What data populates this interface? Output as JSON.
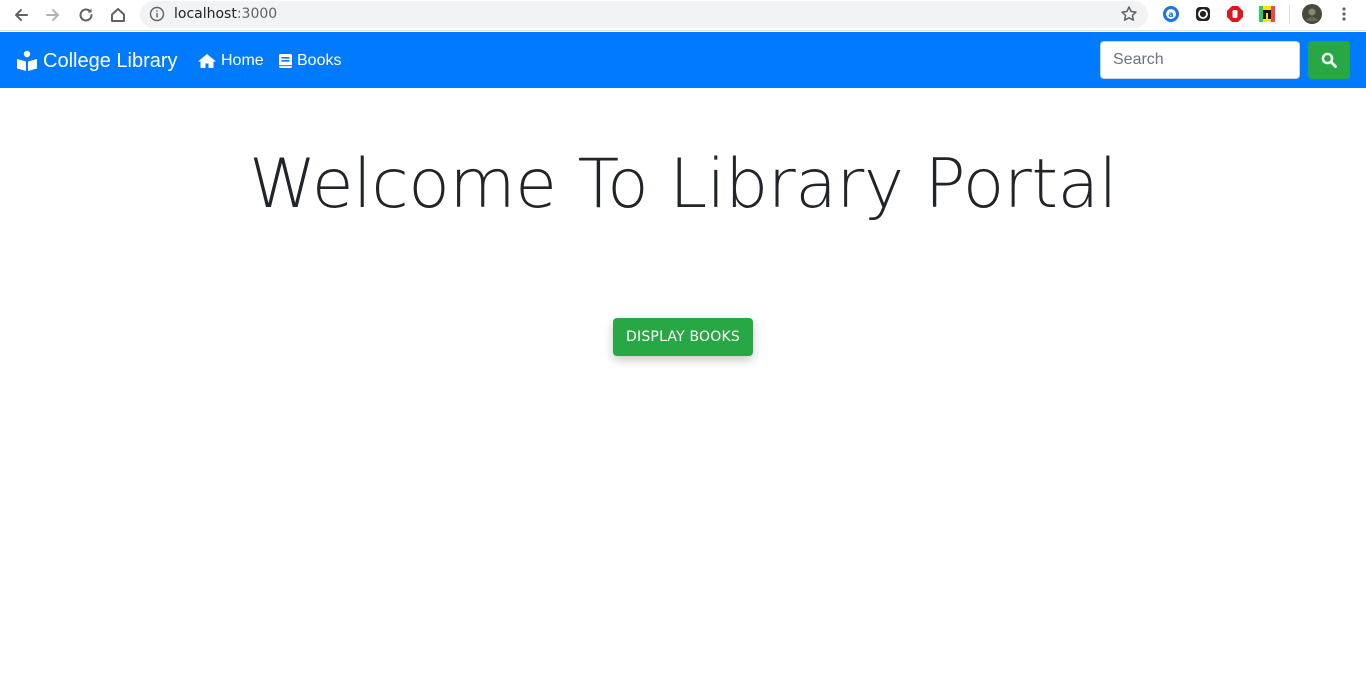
{
  "browser": {
    "url_host": "localhost",
    "url_port": ":3000"
  },
  "navbar": {
    "brand": "College Library",
    "links": [
      {
        "label": "Home",
        "icon": "home-icon"
      },
      {
        "label": "Books",
        "icon": "book-icon"
      }
    ],
    "search": {
      "placeholder": "Search",
      "button_icon": "search-icon"
    },
    "colors": {
      "navbar_bg": "#007bff",
      "success": "#28a745"
    }
  },
  "main": {
    "title": "Welcome To Library Portal",
    "display_button": "DISPLAY BOOKS"
  }
}
